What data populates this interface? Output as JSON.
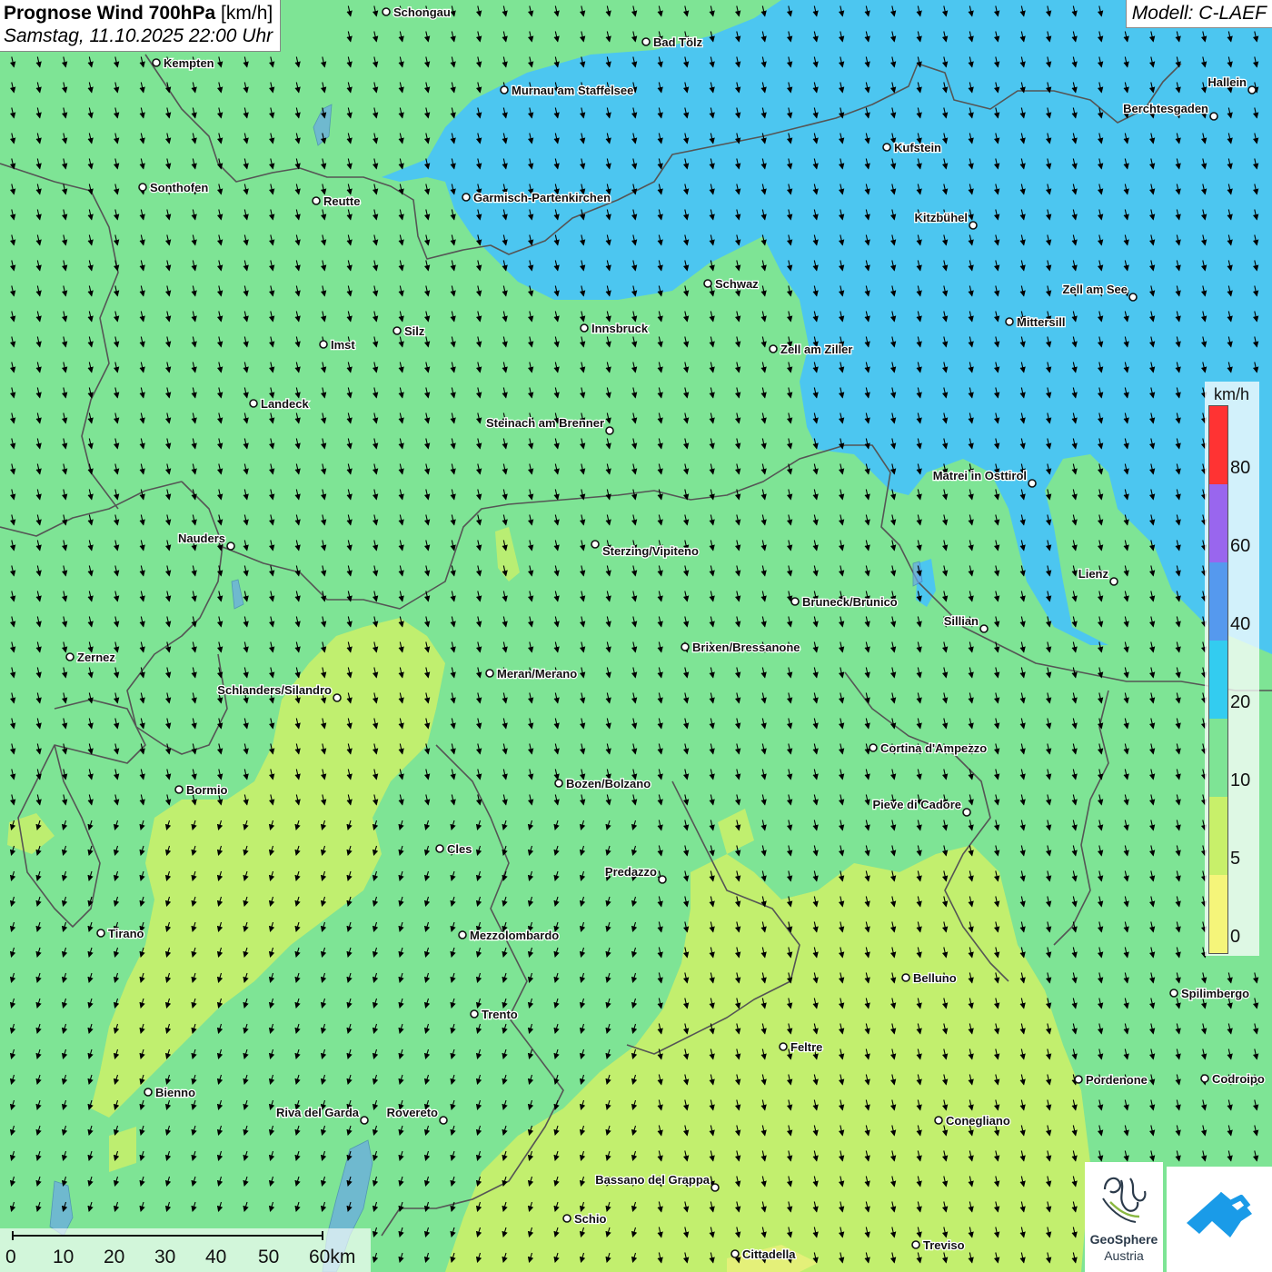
{
  "title": {
    "main": "Prognose Wind 700hPa",
    "unit": "[km/h]",
    "datetime": "Samstag, 11.10.2025 22:00 Uhr"
  },
  "model": "Modell: C-LAEF",
  "legend": {
    "unit": "km/h",
    "ticks": [
      "80",
      "60",
      "40",
      "20",
      "10",
      "5",
      "0"
    ],
    "colors": [
      "#ff3333",
      "#9966ee",
      "#5599ee",
      "#33ccf0",
      "#7ee495",
      "#c8f06a",
      "#f5f57a"
    ]
  },
  "scale": {
    "labels": [
      "0",
      "10",
      "20",
      "30",
      "40",
      "50",
      "60km"
    ]
  },
  "colors": {
    "green": "#7ee495",
    "blue": "#4cc6f0",
    "yellowgreen": "#c8f06a",
    "yellow": "#e6f07a"
  },
  "wind_direction": "southwest arrows (from north-northwest)",
  "cities": [
    {
      "name": "Schongau"
    },
    {
      "name": "Bad Tölz"
    },
    {
      "name": "Kempten"
    },
    {
      "name": "Murnau am Staffelsee"
    },
    {
      "name": "Hallein"
    },
    {
      "name": "Berchtesgaden"
    },
    {
      "name": "Kufstein"
    },
    {
      "name": "Sonthofen"
    },
    {
      "name": "Reutte"
    },
    {
      "name": "Garmisch-Partenkirchen"
    },
    {
      "name": "Kitzbühel"
    },
    {
      "name": "Schwaz"
    },
    {
      "name": "Zell am See"
    },
    {
      "name": "Mittersill"
    },
    {
      "name": "Innsbruck"
    },
    {
      "name": "Silz"
    },
    {
      "name": "Imst"
    },
    {
      "name": "Zell am Ziller"
    },
    {
      "name": "Landeck"
    },
    {
      "name": "Steinach am Brenner"
    },
    {
      "name": "Matrei in Osttirol"
    },
    {
      "name": "Nauders"
    },
    {
      "name": "Sterzing/Vipiteno"
    },
    {
      "name": "Lienz"
    },
    {
      "name": "Bruneck/Brunico"
    },
    {
      "name": "Sillian"
    },
    {
      "name": "Zernez"
    },
    {
      "name": "Brixen/Bressanone"
    },
    {
      "name": "Meran/Merano"
    },
    {
      "name": "Schlanders/Silandro"
    },
    {
      "name": "Cortina d'Ampezzo"
    },
    {
      "name": "Bormio"
    },
    {
      "name": "Bozen/Bolzano"
    },
    {
      "name": "Pieve di Cadore"
    },
    {
      "name": "Cles"
    },
    {
      "name": "Predazzo"
    },
    {
      "name": "Tirano"
    },
    {
      "name": "Mezzolombardo"
    },
    {
      "name": "Belluno"
    },
    {
      "name": "Spilimbergo"
    },
    {
      "name": "Trento"
    },
    {
      "name": "Feltre"
    },
    {
      "name": "Bienno"
    },
    {
      "name": "Pordenone"
    },
    {
      "name": "Codroipo"
    },
    {
      "name": "Riva del Garda"
    },
    {
      "name": "Rovereto"
    },
    {
      "name": "Conegliano"
    },
    {
      "name": "Bassano del Grappa"
    },
    {
      "name": "Schio"
    },
    {
      "name": "Treviso"
    },
    {
      "name": "Cittadella"
    }
  ],
  "logos": {
    "geosphere_line1": "GeoSphere",
    "geosphere_line2": "Austria"
  }
}
